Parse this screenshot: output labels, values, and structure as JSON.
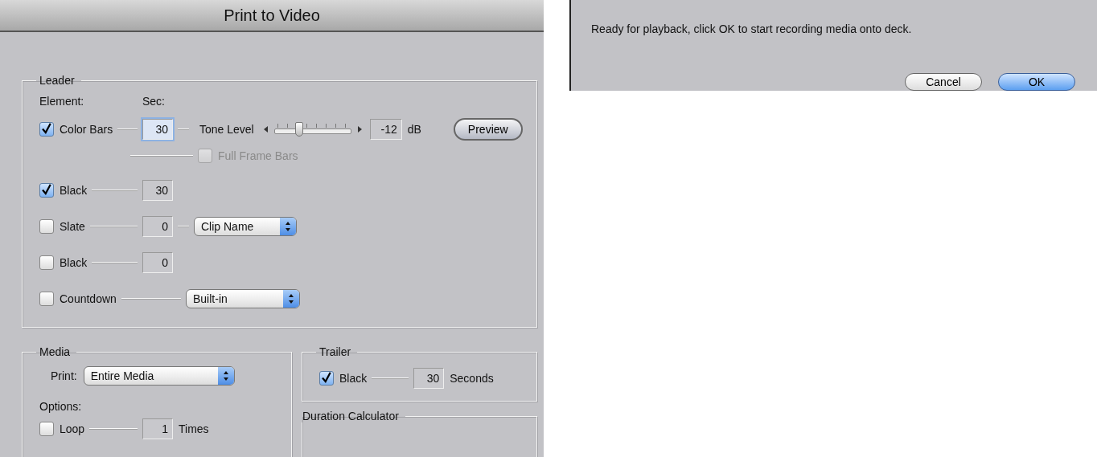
{
  "window": {
    "title": "Print to Video"
  },
  "leader": {
    "title": "Leader",
    "element_heading": "Element:",
    "sec_heading": "Sec:",
    "rows": [
      {
        "kind": "bars",
        "label": "Color Bars",
        "checked": true,
        "seconds": "30",
        "focused": true,
        "tone_label": "Tone Level",
        "level": 0.33,
        "db_value": "-12",
        "db_unit": "dB",
        "button": "Preview",
        "sub_option": {
          "label": "Full Frame Bars",
          "checked": false,
          "disabled": true
        }
      },
      {
        "kind": "plain",
        "label": "Black",
        "checked": true,
        "seconds": "30",
        "focused": false
      },
      {
        "kind": "select",
        "label": "Slate",
        "checked": false,
        "seconds": "0",
        "focused": false,
        "select": "Clip Name"
      },
      {
        "kind": "plain",
        "label": "Black",
        "checked": false,
        "seconds": "0",
        "focused": false
      },
      {
        "kind": "select_only",
        "label": "Countdown",
        "checked": false,
        "select": "Built-in"
      }
    ]
  },
  "media": {
    "title": "Media",
    "print_label": "Print:",
    "print_select": "Entire Media",
    "options_label": "Options:",
    "loop": {
      "label": "Loop",
      "checked": false,
      "value": "1",
      "unit": "Times"
    }
  },
  "trailer": {
    "title": "Trailer",
    "label": "Black",
    "checked": true,
    "value": "30",
    "unit": "Seconds"
  },
  "duration_calculator": {
    "title": "Duration Calculator"
  },
  "dialog": {
    "message": "Ready for playback, click OK to start recording media onto deck.",
    "buttons": [
      {
        "label": "Cancel",
        "default": false
      },
      {
        "label": "OK",
        "default": true
      }
    ]
  }
}
